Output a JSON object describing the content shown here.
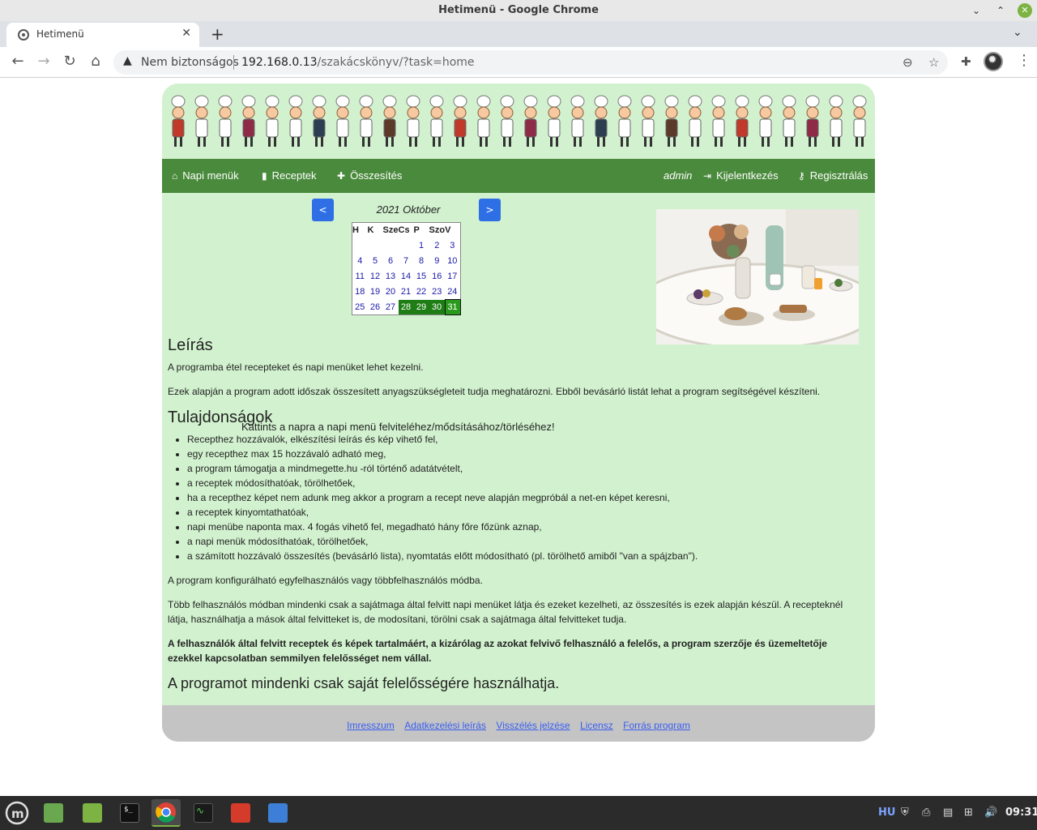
{
  "window": {
    "title": "Hetimenü - Google Chrome"
  },
  "tabs": [
    {
      "title": "Hetimenü"
    }
  ],
  "address_bar": {
    "security_label": "Nem biztonságos",
    "host": "192.168.0.13",
    "path": "/szakácskönyv/?task=home"
  },
  "nav": {
    "items": [
      {
        "label": "Napi menük",
        "icon": "home-icon"
      },
      {
        "label": "Receptek",
        "icon": "book-icon"
      },
      {
        "label": "Összesítés",
        "icon": "plus-icon"
      }
    ],
    "user": "admin",
    "logout": "Kijelentkezés",
    "register": "Regisztrálás"
  },
  "calendar": {
    "prev": "<",
    "next": ">",
    "title": "2021 Október",
    "weekdays": [
      "H",
      "K",
      "Sze",
      "Cs",
      "P",
      "Szo",
      "V"
    ],
    "weeks": [
      [
        "",
        "",
        "",
        "",
        "1",
        "2",
        "3"
      ],
      [
        "4",
        "5",
        "6",
        "7",
        "8",
        "9",
        "10"
      ],
      [
        "11",
        "12",
        "13",
        "14",
        "15",
        "16",
        "17"
      ],
      [
        "18",
        "19",
        "20",
        "21",
        "22",
        "23",
        "24"
      ],
      [
        "25",
        "26",
        "27",
        "28",
        "29",
        "30",
        "31"
      ]
    ],
    "highlighted_days": [
      "28",
      "29",
      "30",
      "31"
    ],
    "hint": "Kattints a napra a napi menü felviteléhez/mődsításához/törléséhez!"
  },
  "content": {
    "heading_desc": "Leírás",
    "desc_p1": "A programba étel recepteket és napi menüket lehet kezelni.",
    "desc_p2": "Ezek alapján a program adott időszak összesített anyagszükségleteit tudja meghatározni. Ebből bevásárló listát lehat a program segítségével készíteni.",
    "heading_features": "Tulajdonságok",
    "features": [
      "Recepthez hozzávalók, elkészítési leírás és kép vihető fel,",
      "egy recepthez max 15 hozzávaló adható meg,",
      "a program támogatja a mindmegette.hu -ról történő adatátvételt,",
      "a receptek módosíthatóak, törölhetőek,",
      "ha a recepthez képet nem adunk meg akkor a program a recept neve alapján megpróbál a net-en képet keresni,",
      "a receptek kinyomtathatóak,",
      "napi menübe naponta max. 4 fogás vihető fel, megadható hány főre főzünk aznap,",
      "a napi menük módosíthatóak, törölhetőek,",
      "a számított hozzávaló összesítés (bevásárló lista), nyomtatás előtt módosítható (pl. törölhető amiből \"van a spájzban\")."
    ],
    "config_p": "A program konfigurálható egyfelhasználós vagy többfelhasználós módba.",
    "multi_p": "Több felhasználós módban mindenki csak a sajátmaga által felvitt napi menüket látja és ezeket kezelheti, az összesítés is ezek alapján készül. A recepteknél látja, használhatja a mások által felvitteket is, de modosítani, törölni csak a sajátmaga által felvitteket tudja.",
    "disclaimer": "A felhasználók által felvitt receptek és képek tartalmáért, a kizárólag az azokat felvivő felhasználó a felelős, a program szerzője és üzemeltetője ezekkel kapcsolatban semmilyen felelősséget nem vállal.",
    "final": "A programot mindenki csak saját felelősségére használhatja."
  },
  "footer": {
    "links": [
      "Imresszum",
      "Adatkezelési leírás",
      "Visszélés jelzése",
      "Licensz",
      "Forrás program"
    ]
  },
  "taskbar": {
    "language": "HU",
    "clock": "09:31"
  },
  "colors": {
    "page_bg": "#d2f2cf",
    "nav_bg": "#4a8a3c",
    "button_blue": "#2f6fe6",
    "calendar_highlight": "#1e7d14",
    "footer_bg": "#c4c4c4",
    "link": "#3a5ff0"
  }
}
